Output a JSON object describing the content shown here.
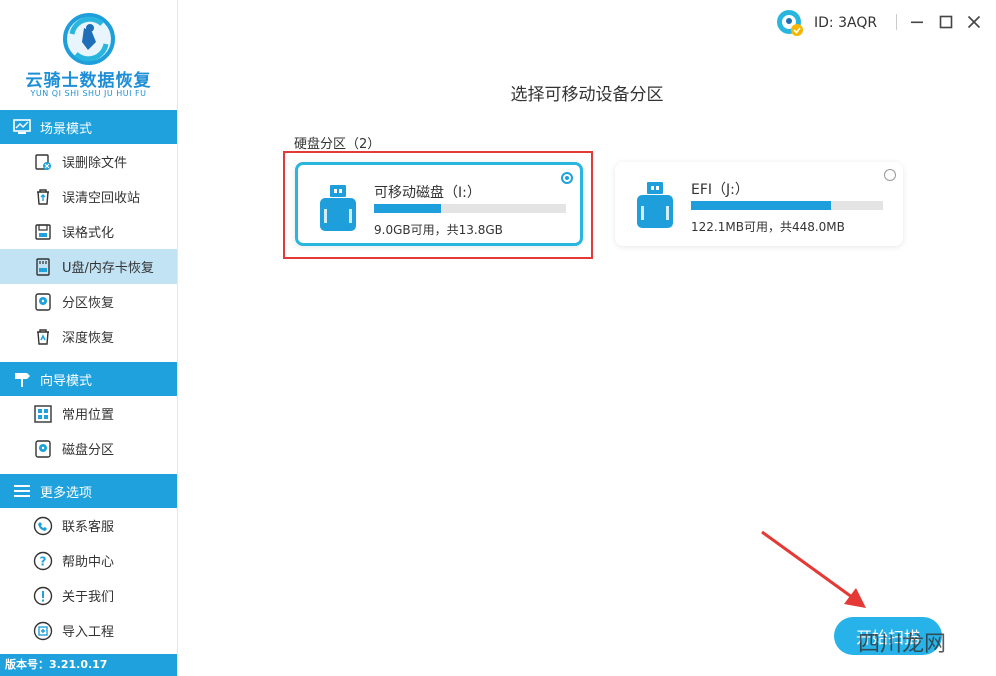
{
  "app": {
    "logo_cn": "云骑士数据恢复",
    "logo_en": "YUN QI SHI SHU JU HUI FU",
    "version": "版本号：3.21.0.17"
  },
  "user": {
    "id": "ID: 3AQR"
  },
  "sidebar": {
    "sections": [
      {
        "title": "场景模式",
        "icon": "monitor-icon",
        "items": [
          {
            "label": "误删除文件",
            "icon": "deleted-file-icon"
          },
          {
            "label": "误清空回收站",
            "icon": "recycle-bin-icon"
          },
          {
            "label": "误格式化",
            "icon": "format-icon"
          },
          {
            "label": "U盘/内存卡恢复",
            "icon": "usb-card-icon",
            "active": true
          },
          {
            "label": "分区恢复",
            "icon": "partition-disk-icon"
          },
          {
            "label": "深度恢复",
            "icon": "deep-recovery-icon"
          }
        ]
      },
      {
        "title": "向导模式",
        "icon": "signpost-icon",
        "items": [
          {
            "label": "常用位置",
            "icon": "windows-icon"
          },
          {
            "label": "磁盘分区",
            "icon": "disk-partition-icon"
          }
        ]
      },
      {
        "title": "更多选项",
        "icon": "menu-icon",
        "items": [
          {
            "label": "联系客服",
            "icon": "phone-icon"
          },
          {
            "label": "帮助中心",
            "icon": "help-icon"
          },
          {
            "label": "关于我们",
            "icon": "info-icon"
          },
          {
            "label": "导入工程",
            "icon": "import-icon"
          }
        ]
      }
    ]
  },
  "main": {
    "title": "选择可移动设备分区",
    "subtitle": "硬盘分区（2）",
    "partitions": [
      {
        "name": "可移动磁盘（I:）",
        "capacity": "9.0GB可用，共13.8GB",
        "used_fraction": 0.35,
        "selected": true
      },
      {
        "name": "EFI（J:）",
        "capacity": "122.1MB可用，共448.0MB",
        "used_fraction": 0.73,
        "selected": false
      }
    ],
    "start_button": "开始扫描"
  },
  "watermark": "四川龙网",
  "colors": {
    "accent": "#1ea1dd",
    "active_bg": "#c2e3f4",
    "highlight": "#e53935",
    "button": "#27b3ea"
  }
}
